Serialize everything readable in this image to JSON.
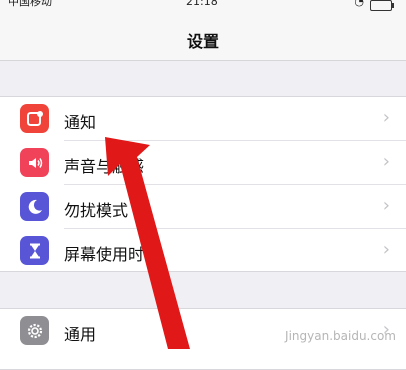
{
  "status_bar": {
    "carrier": "中国移动",
    "time": "21:18"
  },
  "nav": {
    "title": "设置"
  },
  "group1": {
    "items": [
      {
        "label": "通知",
        "icon": "notification-icon",
        "color": "#f0443a"
      },
      {
        "label": "声音与触感",
        "icon": "sound-icon",
        "color": "#f0435a"
      },
      {
        "label": "勿扰模式",
        "icon": "moon-icon",
        "color": "#5856d6"
      },
      {
        "label": "屏幕使用时间",
        "icon": "hourglass-icon",
        "color": "#5856d6"
      }
    ]
  },
  "group2": {
    "items": [
      {
        "label": "通用",
        "icon": "gear-icon",
        "color": "#8e8e93"
      }
    ]
  },
  "annotation": {
    "color": "#e01818"
  },
  "watermark": "Jingyan.baidu.com"
}
